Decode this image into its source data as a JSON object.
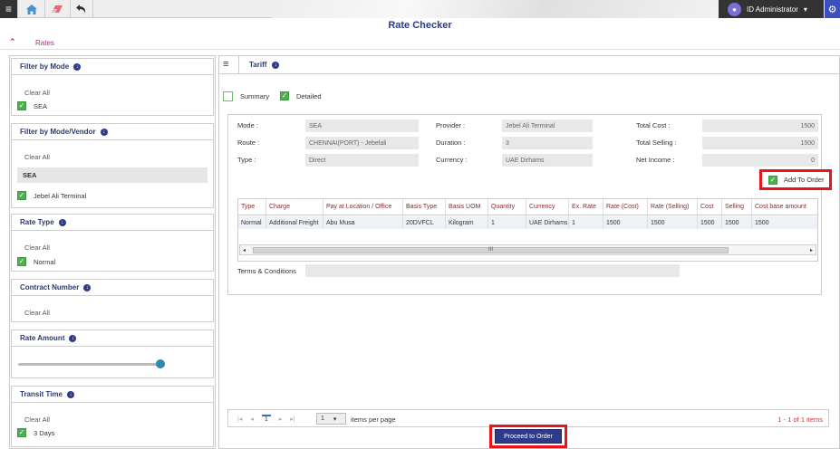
{
  "app": {
    "title": "Rate Checker"
  },
  "user": {
    "name": "ID Administrator"
  },
  "breadcrumb": {
    "label": "Rates"
  },
  "filters": {
    "mode": {
      "title": "Filter by Mode",
      "clear": "Clear All",
      "checked": "SEA"
    },
    "mode_vendor": {
      "title": "Filter by Mode/Vendor",
      "clear": "Clear All",
      "selected": "SEA",
      "checked": "Jebel Ali Terminal"
    },
    "rate_type": {
      "title": "Rate Type",
      "clear": "Clear All",
      "checked": "Normal"
    },
    "contract": {
      "title": "Contract Number",
      "clear": "Clear All"
    },
    "rate_amount": {
      "title": "Rate Amount",
      "slider_fraction": 1.0
    },
    "transit": {
      "title": "Transit Time",
      "clear": "Clear All",
      "checked": "3 Days"
    }
  },
  "tariff": {
    "title": "Tariff",
    "summary": "Summary",
    "detailed": "Detailed",
    "fields": {
      "mode_label": "Mode :",
      "mode": "SEA",
      "route_label": "Route :",
      "route": "CHENNAI(PORT) - Jebelali",
      "type_label": "Type :",
      "type": "Direct",
      "provider_label": "Provider :",
      "provider": "Jebel Ali Terminal",
      "duration_label": "Duration :",
      "duration": "3",
      "currency_label": "Currency :",
      "currency": "UAE Dirhams",
      "total_cost_label": "Total Cost :",
      "total_cost": "1500",
      "total_selling_label": "Total Selling :",
      "total_selling": "1500",
      "net_income_label": "Net Income :",
      "net_income": "0"
    },
    "add_to_order": "Add To Order",
    "grid": {
      "columns": [
        "Type",
        "Charge",
        "Pay at Location / Office",
        "Basis Type",
        "Basis UOM",
        "Quantity",
        "Currency",
        "Ex. Rate",
        "Rate (Cost)",
        "Rate (Selling)",
        "Cost",
        "Selling",
        "Cost base amount"
      ],
      "row": [
        "Normal",
        "Additional Freight",
        "Abu Musa",
        "20DVFCL",
        "Kilogram",
        "1",
        "UAE Dirhams",
        "1",
        "1500",
        "1500",
        "1500",
        "1500",
        "1500"
      ],
      "scroll_glyph": "III"
    },
    "terms_label": "Terms & Conditions",
    "pager": {
      "page": "1",
      "per_page": "1",
      "per_page_label": "items per page",
      "count": "1 - 1 of 1 items"
    },
    "proceed": "Proceed to Order"
  }
}
